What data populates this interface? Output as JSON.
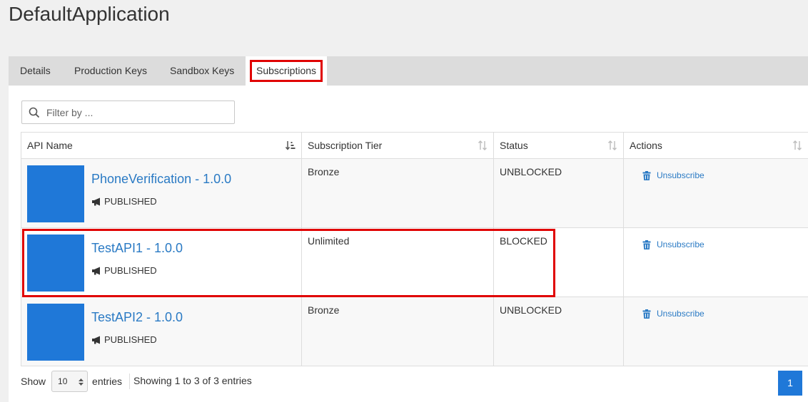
{
  "app": {
    "title": "DefaultApplication"
  },
  "tabs": [
    {
      "label": "Details"
    },
    {
      "label": "Production Keys"
    },
    {
      "label": "Sandbox Keys"
    },
    {
      "label": "Subscriptions",
      "active": true
    }
  ],
  "filter": {
    "placeholder": "Filter by ...",
    "value": ""
  },
  "table": {
    "columns": [
      "API Name",
      "Subscription Tier",
      "Status",
      "Actions"
    ],
    "rows": [
      {
        "api_name": "PhoneVerification - 1.0.0",
        "api_state": "PUBLISHED",
        "tier": "Bronze",
        "status": "UNBLOCKED",
        "action": "Unsubscribe"
      },
      {
        "api_name": "TestAPI1 - 1.0.0",
        "api_state": "PUBLISHED",
        "tier": "Unlimited",
        "status": "BLOCKED",
        "action": "Unsubscribe"
      },
      {
        "api_name": "TestAPI2 - 1.0.0",
        "api_state": "PUBLISHED",
        "tier": "Bronze",
        "status": "UNBLOCKED",
        "action": "Unsubscribe"
      }
    ]
  },
  "footer": {
    "show_label": "Show",
    "page_size": "10",
    "entries_label": "entries",
    "info": "Showing 1 to 3 of 3 entries",
    "current_page": "1"
  },
  "colors": {
    "accent": "#1f78d8",
    "link": "#2a7ac4",
    "highlight": "#e00000"
  },
  "icons": {
    "filter": "search-icon",
    "sort": "sort-icon",
    "state": "megaphone-icon",
    "action": "trash-icon"
  }
}
